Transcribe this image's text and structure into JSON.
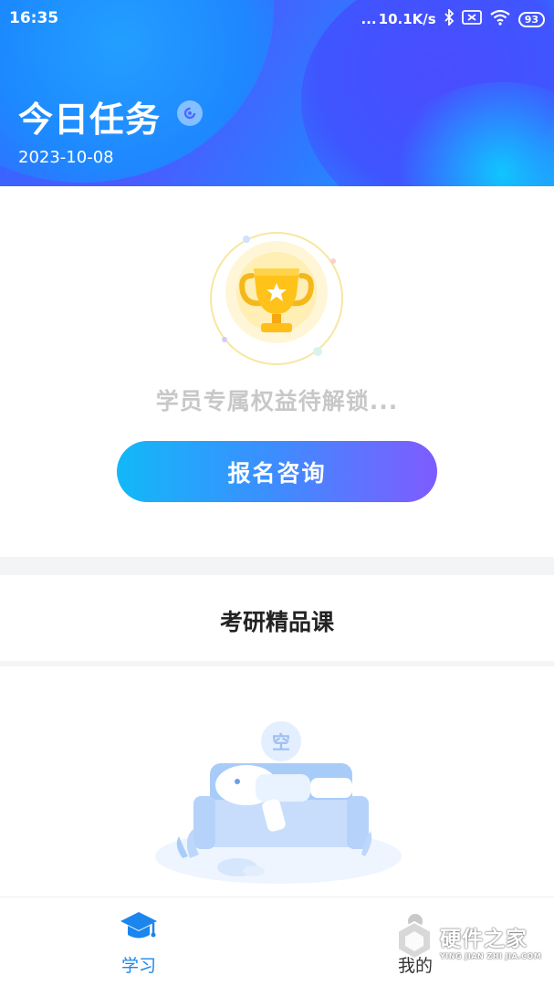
{
  "status_bar": {
    "time": "16:35",
    "signal": "...",
    "speed": "10.1K/s",
    "battery": "93",
    "icons": [
      "bluetooth-icon",
      "sim-icon",
      "wifi-icon",
      "battery-icon"
    ]
  },
  "header": {
    "title": "今日任务",
    "date": "2023-10-08"
  },
  "benefits": {
    "hint": "学员专属权益待解锁...",
    "button_label": "报名咨询"
  },
  "courses": {
    "title": "考研精品课",
    "empty_badge": "空"
  },
  "bottom_nav": {
    "items": [
      {
        "label": "学习",
        "icon": "graduation-cap-icon",
        "active": true
      },
      {
        "label": "我的",
        "icon": "user-icon",
        "active": false
      }
    ]
  },
  "watermark": {
    "cn": "硬件之家",
    "en": "YING JIAN ZHI JIA.COM"
  },
  "colors": {
    "accent": "#1a86ee",
    "button_start": "#12b8f8",
    "button_end": "#7f5bff",
    "hint_gray": "#c8c8c8"
  }
}
